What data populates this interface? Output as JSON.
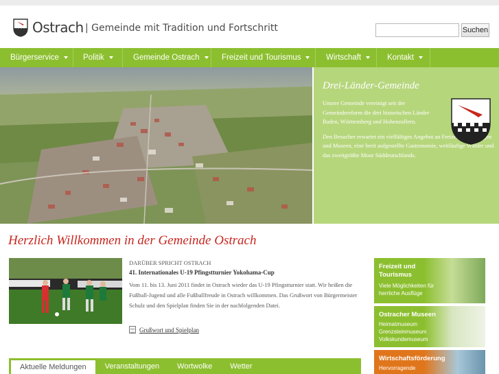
{
  "header": {
    "site_name": "Ostrach",
    "slogan": "| Gemeinde mit Tradition und Fortschritt",
    "search_placeholder": "",
    "search_button": "Suchen",
    "logo_icon": "coat-of-arms-icon"
  },
  "nav": {
    "items": [
      {
        "label": "Bürgerservice"
      },
      {
        "label": "Politik"
      },
      {
        "label": "Gemeinde Ostrach"
      },
      {
        "label": "Freizeit und Tourismus"
      },
      {
        "label": "Wirtschaft"
      },
      {
        "label": "Kontakt"
      }
    ]
  },
  "hero": {
    "title": "Drei-Länder-Gemeinde",
    "paragraph1": "Unsere Gemeinde vereinigt seit der Gemeindereform die drei historischen Länder Baden, Württemberg und Hohenzollern.",
    "paragraph2": "Den Besucher erwartet ein vielfältiges Angebot an Freizeiteinrichtungen und Museen, eine breit aufgestellte Gastronomie, weitläufige Wälder und das zweitgrößte Moor Süddeutschlands."
  },
  "welcome": "Herzlich Willkommen in der Gemeinde Ostrach",
  "article": {
    "kicker": "DARÜBER SPRICHT OSTRACH",
    "title": "41. Internationales U-19 Pfingstturnier Yokohama-Cup",
    "body": "Vom 11. bis 13. Juni 2011 findet in Ostrach wieder das U-19 Pfingstturnier statt. Wir heißen die Fußball-Jugend und alle Fußballfreude in Ostrach willkommen. Das Grußwort von Bürgermeister Schulz und den Spielplan finden Sie in der nachfolgenden Datei.",
    "link": "Grußwort und Spielplan"
  },
  "tabs": [
    {
      "label": "Aktuelle Meldungen"
    },
    {
      "label": "Veranstaltungen"
    },
    {
      "label": "Wortwolke"
    },
    {
      "label": "Wetter"
    }
  ],
  "side_boxes": [
    {
      "title": "Freizeit und Tourismus",
      "lines": [
        "Viele Möglichkeiten für",
        "herrliche Ausflüge"
      ]
    },
    {
      "title": "Ostracher Museen",
      "lines": [
        "Heimatmuseum",
        "Grenzsteinmuseum",
        "Volkskundemuseum"
      ]
    },
    {
      "title": "Wirtschaftsförderung",
      "lines": [
        "Hervorragende"
      ]
    }
  ],
  "colors": {
    "nav_green": "#8cbf2f",
    "panel_green": "#b6d67c",
    "welcome_red": "#c8261e",
    "wirtschaft_orange": "#e0761c"
  }
}
